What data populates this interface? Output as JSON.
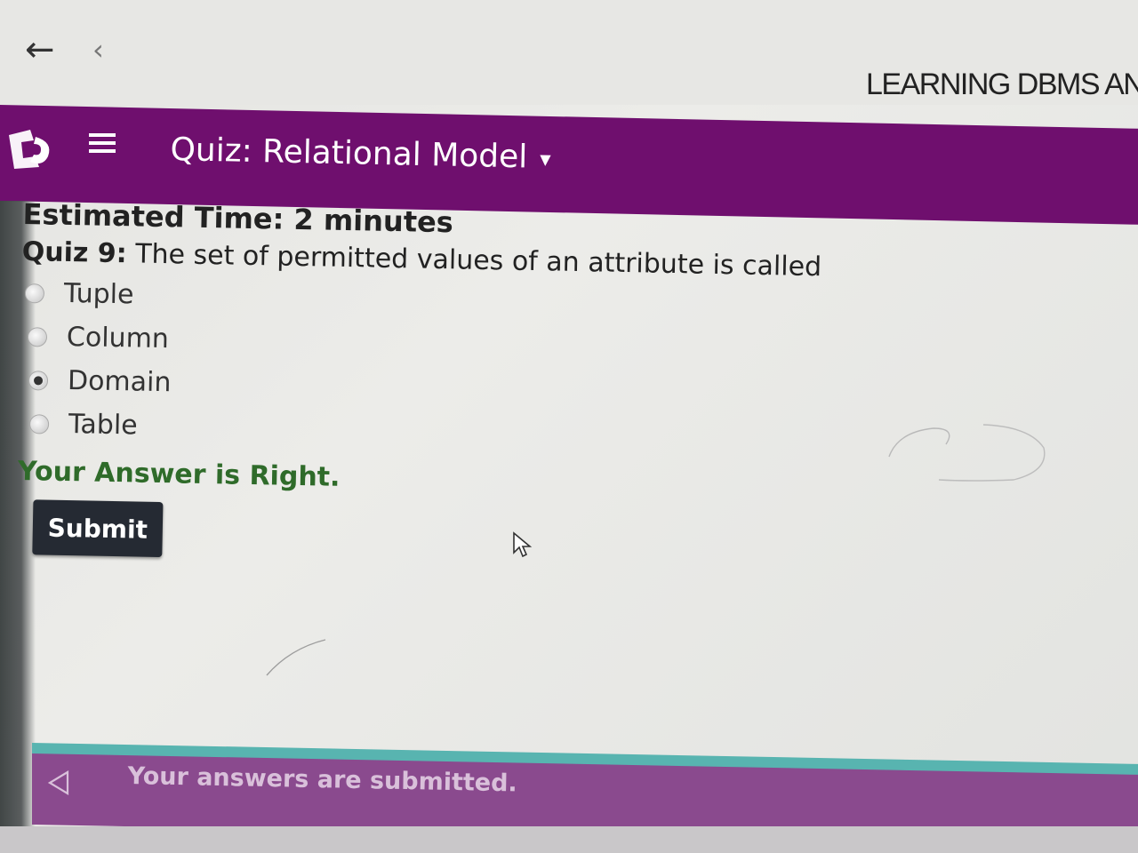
{
  "browser": {
    "back_icon": "arrow-left-icon",
    "prev_icon": "chevron-left-icon",
    "site_title": "LEARNING DBMS AND"
  },
  "header": {
    "logo_icon": "brand-logo-icon",
    "menu_icon": "hamburger-menu-icon",
    "title": "Quiz: Relational Model",
    "dropdown_icon": "caret-down-icon",
    "color": "#6f0f6e"
  },
  "quiz": {
    "estimated_time": "Estimated Time: 2 minutes",
    "question_number": "Quiz 9:",
    "question_text": " The set of permitted values of an attribute is called",
    "options": [
      {
        "label": "Tuple",
        "selected": false
      },
      {
        "label": "Column",
        "selected": false
      },
      {
        "label": "Domain",
        "selected": true
      },
      {
        "label": "Table",
        "selected": false
      }
    ],
    "result": "Your Answer is Right.",
    "result_color": "#2f6b2a",
    "submit_label": "Submit"
  },
  "footer": {
    "icon": "triangle-left-icon",
    "message": "Your answers are submitted.",
    "color": "#8a4a8e",
    "accent": "#58b4b0"
  }
}
